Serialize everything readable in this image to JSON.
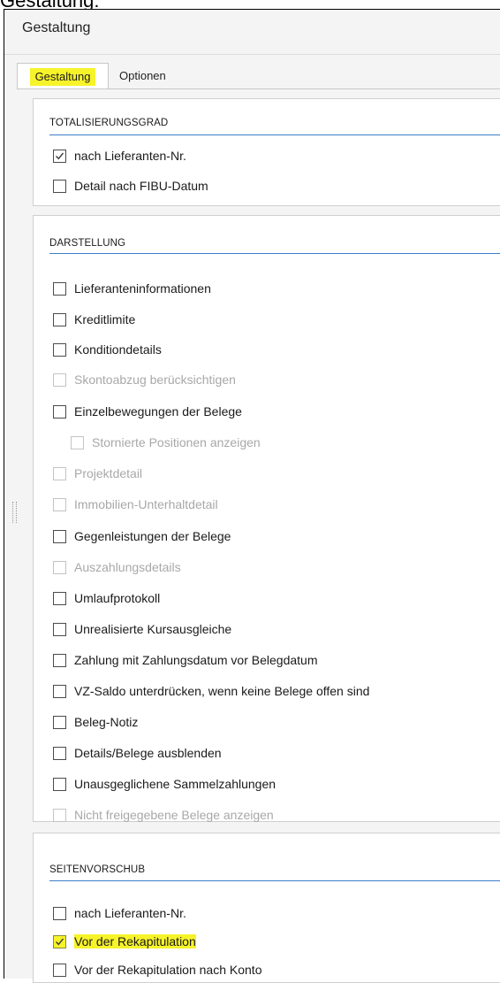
{
  "doc_heading": "Gestaltung:",
  "window": {
    "title": "Gestaltung"
  },
  "tabs": [
    {
      "label": "Gestaltung",
      "active": true
    },
    {
      "label": "Optionen",
      "active": false
    }
  ],
  "highlight_color": "#f7f32a",
  "accent_color": "#3d7fc9",
  "sections": {
    "totalisierungsgrad": {
      "title": "TOTALISIERUNGSGRAD",
      "options": [
        {
          "label": "nach Lieferanten-Nr.",
          "checked": true,
          "enabled": true
        },
        {
          "label": "Detail nach FIBU-Datum",
          "checked": false,
          "enabled": true
        }
      ]
    },
    "darstellung": {
      "title": "DARSTELLUNG",
      "options": [
        {
          "label": "Lieferanteninformationen",
          "checked": false,
          "enabled": true
        },
        {
          "label": "Kreditlimite",
          "checked": false,
          "enabled": true
        },
        {
          "label": "Konditiondetails",
          "checked": false,
          "enabled": true
        },
        {
          "label": "Skontoabzug berücksichtigen",
          "checked": false,
          "enabled": false
        },
        {
          "label": "Einzelbewegungen der Belege",
          "checked": false,
          "enabled": true
        },
        {
          "label": "Stornierte Positionen anzeigen",
          "checked": false,
          "enabled": false
        },
        {
          "label": "Projektdetail",
          "checked": false,
          "enabled": false
        },
        {
          "label": "Immobilien-Unterhaltdetail",
          "checked": false,
          "enabled": false
        },
        {
          "label": "Gegenleistungen der Belege",
          "checked": false,
          "enabled": true
        },
        {
          "label": "Auszahlungsdetails",
          "checked": false,
          "enabled": false
        },
        {
          "label": "Umlaufprotokoll",
          "checked": false,
          "enabled": true
        },
        {
          "label": "Unrealisierte Kursausgleiche",
          "checked": false,
          "enabled": true
        },
        {
          "label": "Zahlung mit Zahlungsdatum vor Belegdatum",
          "checked": false,
          "enabled": true
        },
        {
          "label": "VZ-Saldo unterdrücken, wenn keine Belege offen sind",
          "checked": false,
          "enabled": true
        },
        {
          "label": "Beleg-Notiz",
          "checked": false,
          "enabled": true
        },
        {
          "label": "Details/Belege ausblenden",
          "checked": false,
          "enabled": true
        },
        {
          "label": "Unausgeglichene Sammelzahlungen",
          "checked": false,
          "enabled": true
        },
        {
          "label": "Nicht freigegebene Belege anzeigen",
          "checked": false,
          "enabled": false
        }
      ]
    },
    "seitenvorschub": {
      "title": "SEITENVORSCHUB",
      "options": [
        {
          "label": "nach Lieferanten-Nr.",
          "checked": false,
          "enabled": true
        },
        {
          "label": "Vor der Rekapitulation",
          "checked": true,
          "enabled": true
        },
        {
          "label": "Vor der Rekapitulation nach Konto",
          "checked": false,
          "enabled": true
        }
      ]
    }
  }
}
